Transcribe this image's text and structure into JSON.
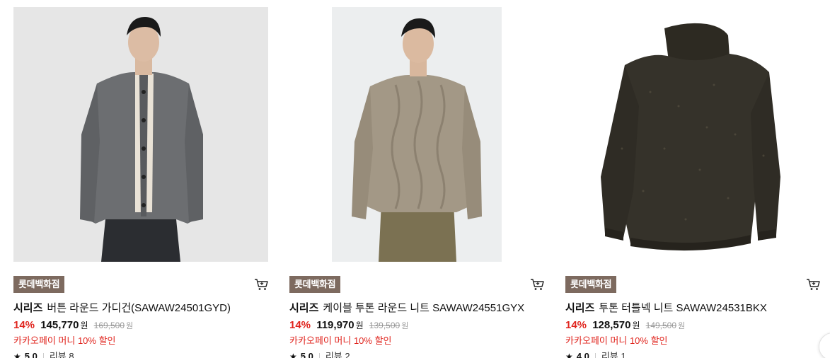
{
  "products": [
    {
      "brand": "롯데백화점",
      "series": "시리즈",
      "name": "버튼 라운드 가디건(SAWAW24501GYD)",
      "discount": "14%",
      "sale_price": "145,770",
      "currency": "원",
      "original_price": "169,500",
      "original_currency": "원",
      "promo": "카카오페이 머니 10% 할인",
      "rating": "5.0",
      "reviews": "리뷰 8",
      "image_icon": "gray-cardigan-model-photo"
    },
    {
      "brand": "롯데백화점",
      "series": "시리즈",
      "name": "케이블 투톤 라운드 니트 SAWAW24551GYX",
      "discount": "14%",
      "sale_price": "119,970",
      "currency": "원",
      "original_price": "139,500",
      "original_currency": "원",
      "promo": "카카오페이 머니 10% 할인",
      "rating": "5.0",
      "reviews": "리뷰 2",
      "image_icon": "beige-cable-knit-model-photo"
    },
    {
      "brand": "롯데백화점",
      "series": "시리즈",
      "name": "투톤 터틀넥 니트 SAWAW24531BKX",
      "discount": "14%",
      "sale_price": "128,570",
      "currency": "원",
      "original_price": "149,500",
      "original_currency": "원",
      "promo": "카카오페이 머니 10% 할인",
      "rating": "4.0",
      "reviews": "리뷰 1",
      "image_icon": "dark-turtleneck-product-photo"
    }
  ],
  "colors": {
    "brand_badge": "#7d6a5f",
    "discount": "#e0241d",
    "promo": "#e0241d"
  }
}
